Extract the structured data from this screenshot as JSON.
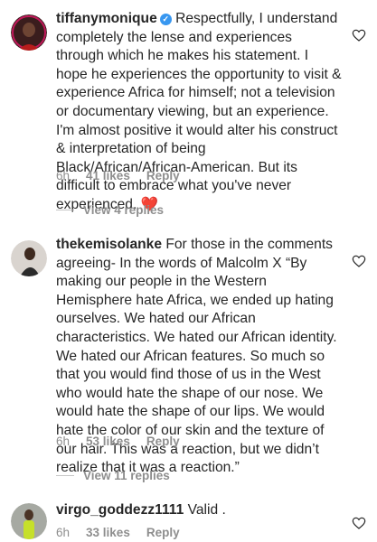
{
  "comments": [
    {
      "username": "tiffanymonique",
      "verified": true,
      "text": "Respectfully, I understand completely the lense and experiences through which he makes his statement. I hope he experiences the opportunity to visit & experience Africa for himself; not a television or documentary viewing, but an experience. I'm almost positive it would alter his construct & interpretation of being Black/African/African-American. But its difficult to embrace what you've never experienced.",
      "emoji": "❤️",
      "time": "6h",
      "likes": "41 likes",
      "reply": "Reply",
      "view_replies": "View 4 replies"
    },
    {
      "username": "thekemisolanke",
      "verified": false,
      "text": "For those in the comments agreeing- In the words of Malcolm X “By making our people in the Western Hemisphere hate Africa, we ended up hating ourselves. We hated our African characteristics. We hated our African identity. We hated our African features. So much so that you would find those of us in the West who would hate the shape of our nose. We would hate the shape of our lips. We would hate the color of our skin and the texture of our hair. This was a reaction, but we didn’t realize that it was a reaction.”",
      "time": "6h",
      "likes": "53 likes",
      "reply": "Reply",
      "view_replies": "View 11 replies"
    },
    {
      "username": "virgo_goddezz1111",
      "verified": false,
      "text": "Valid .",
      "time": "6h",
      "likes": "33 likes",
      "reply": "Reply"
    }
  ],
  "colors": {
    "text": "#262626",
    "meta": "#8e8e8e",
    "verified": "#3897f0",
    "heart_emoji": "#e0245e"
  },
  "icons": {
    "like": "heart-outline-icon",
    "verified": "verified-badge-icon"
  }
}
